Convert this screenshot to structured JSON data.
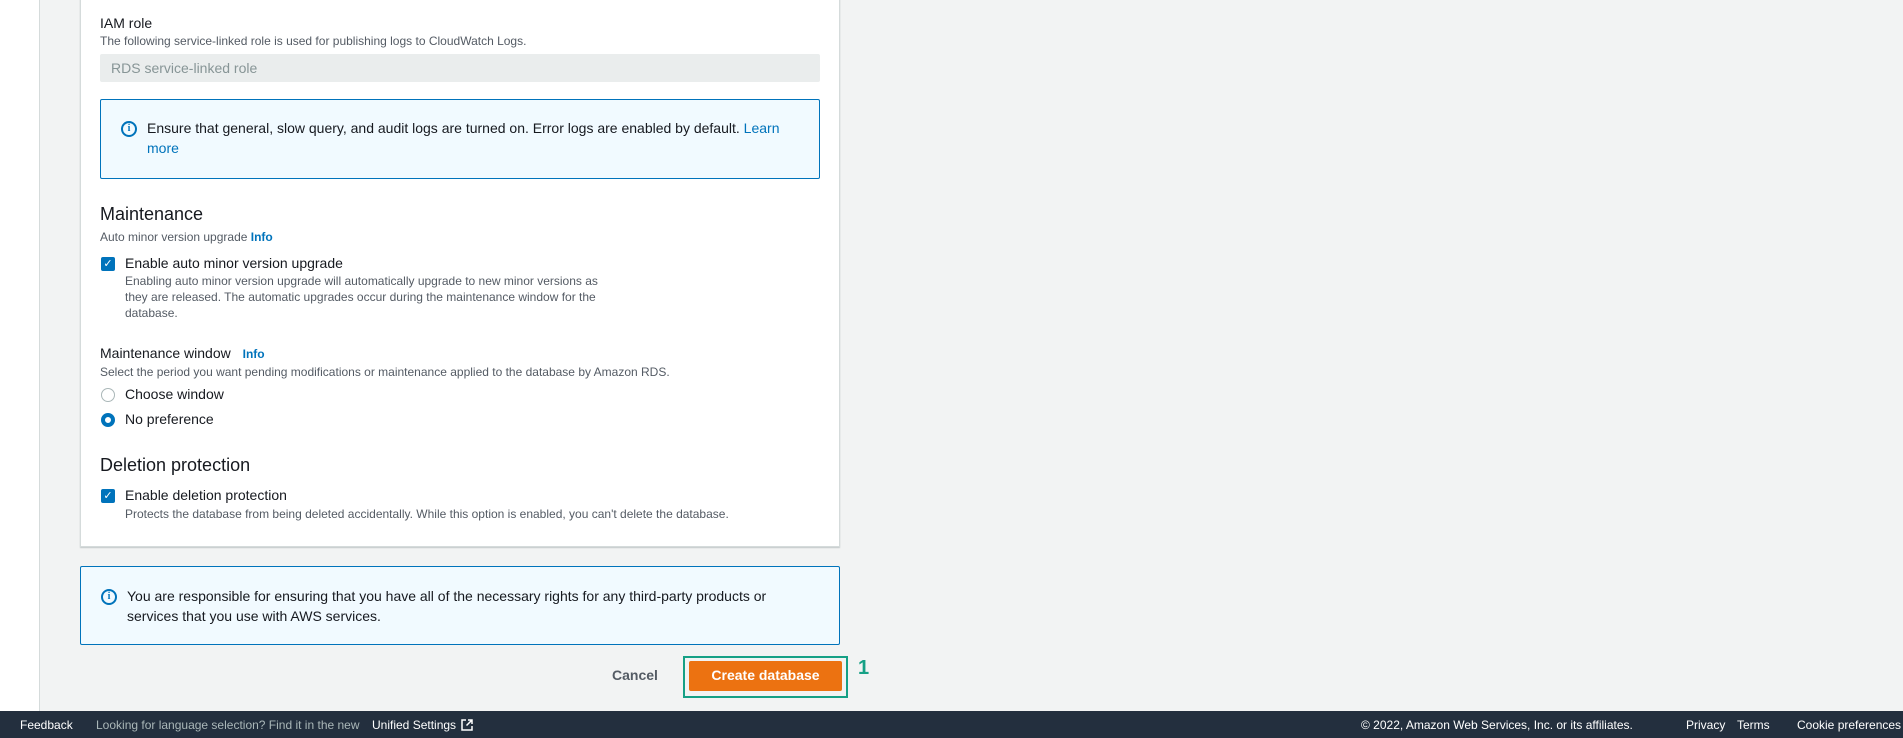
{
  "iam": {
    "label": "IAM role",
    "desc": "The following service-linked role is used for publishing logs to CloudWatch Logs.",
    "value": "RDS service-linked role"
  },
  "logs_alert": {
    "text": "Ensure that general, slow query, and audit logs are turned on. Error logs are enabled by default.",
    "link_line1": "Learn",
    "link_line2": "more",
    "icon": "info-icon"
  },
  "maintenance": {
    "title": "Maintenance",
    "subtitle": "Auto minor version upgrade",
    "info": "Info",
    "auto_upgrade": {
      "label": "Enable auto minor version upgrade",
      "checked": true,
      "desc_line1": "Enabling auto minor version upgrade will automatically upgrade to new minor versions as",
      "desc_line2": "they are released. The automatic upgrades occur during the maintenance window for the",
      "desc_line3": "database."
    },
    "window": {
      "label": "Maintenance window",
      "info": "Info",
      "desc": "Select the period you want pending modifications or maintenance applied to the database by Amazon RDS.",
      "options": [
        "Choose window",
        "No preference"
      ],
      "selected": "No preference"
    }
  },
  "deletion": {
    "title": "Deletion protection",
    "label": "Enable deletion protection",
    "checked": true,
    "desc": "Protects the database from being deleted accidentally. While this option is enabled, you can't delete the database."
  },
  "rights_alert": {
    "line1": "You are responsible for ensuring that you have all of the necessary rights for any third-party products or",
    "line2": "services that you use with AWS services.",
    "icon": "info-icon"
  },
  "actions": {
    "cancel": "Cancel",
    "create": "Create database",
    "marker": "1"
  },
  "footer": {
    "feedback": "Feedback",
    "language_prompt": "Looking for language selection? Find it in the new",
    "unified_settings": "Unified Settings",
    "copyright": "© 2022, Amazon Web Services, Inc. or its affiliates.",
    "privacy": "Privacy",
    "terms": "Terms",
    "cookie": "Cookie preferences"
  },
  "colors": {
    "primary_button": "#ec7211",
    "link": "#0073bb",
    "footer_bg": "#232f3e",
    "highlight": "#16a085"
  }
}
